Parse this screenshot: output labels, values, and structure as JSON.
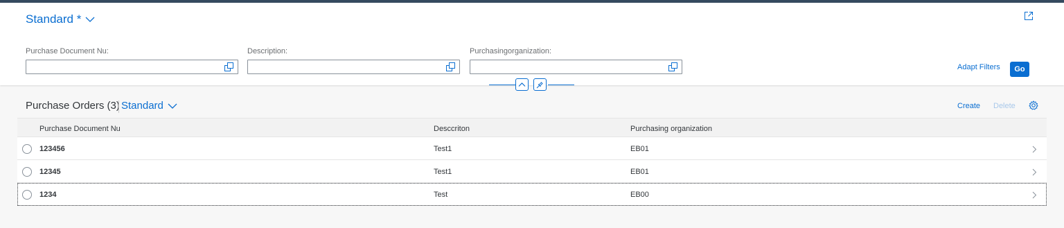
{
  "header": {
    "variant_label": "Standard *",
    "filters": [
      {
        "label": "Purchase Document Nu:",
        "value": "",
        "placeholder": ""
      },
      {
        "label": "Description:",
        "value": "",
        "placeholder": ""
      },
      {
        "label": "Purchasingorganization:",
        "value": "",
        "placeholder": ""
      }
    ],
    "adapt_filters_label": "Adapt Filters",
    "go_label": "Go"
  },
  "table": {
    "title": "Purchase Orders (3)",
    "variant_label": "Standard",
    "create_label": "Create",
    "delete_label": "Delete",
    "columns": [
      "Purchase Document Nu",
      "Desccriton",
      "Purchasing organization"
    ],
    "rows": [
      {
        "doc": "123456",
        "desc": "Test1",
        "org": "EB01"
      },
      {
        "doc": "12345",
        "desc": "Test1",
        "org": "EB01"
      },
      {
        "doc": "1234",
        "desc": "Test",
        "org": "EB00"
      }
    ]
  },
  "colors": {
    "accent": "#0a6ed1",
    "shell": "#354a5f",
    "text": "#32363a",
    "label": "#6a6d70"
  },
  "icons": [
    "chevron-down-icon",
    "share-icon",
    "value-help-icon",
    "collapse-icon",
    "pin-icon",
    "settings-icon",
    "chevron-right-icon"
  ]
}
